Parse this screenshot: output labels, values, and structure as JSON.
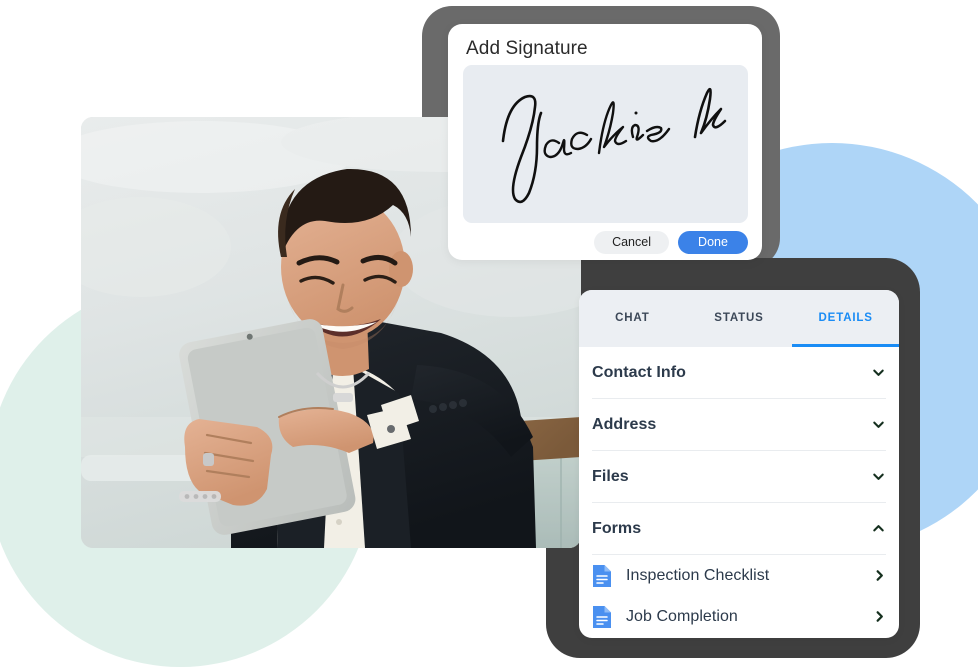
{
  "background": {
    "mint_circle_color": "#dff0ea",
    "blue_circle_color": "#aed5f7",
    "device_frame_top_color": "#6a6a6a",
    "device_frame_bottom_color": "#3f3f3f"
  },
  "photo": {
    "alt": "Smiling young man in dark suit using a tablet while leaning on a wooden railing"
  },
  "signature_dialog": {
    "title": "Add Signature",
    "signature_text": "Jackie k",
    "canvas_color": "#e8ecf1",
    "cancel_label": "Cancel",
    "done_label": "Done",
    "done_color": "#3b82e8"
  },
  "details_panel": {
    "accent_color": "#1a8cf5",
    "tabs": [
      {
        "label": "CHAT",
        "active": false
      },
      {
        "label": "STATUS",
        "active": false
      },
      {
        "label": "DETAILS",
        "active": true
      }
    ],
    "sections": [
      {
        "label": "Contact Info",
        "expanded": false
      },
      {
        "label": "Address",
        "expanded": false
      },
      {
        "label": "Files",
        "expanded": false
      },
      {
        "label": "Forms",
        "expanded": true
      }
    ],
    "forms": [
      {
        "label": "Inspection Checklist",
        "icon": "document-icon"
      },
      {
        "label": "Job Completion",
        "icon": "document-icon"
      }
    ]
  }
}
